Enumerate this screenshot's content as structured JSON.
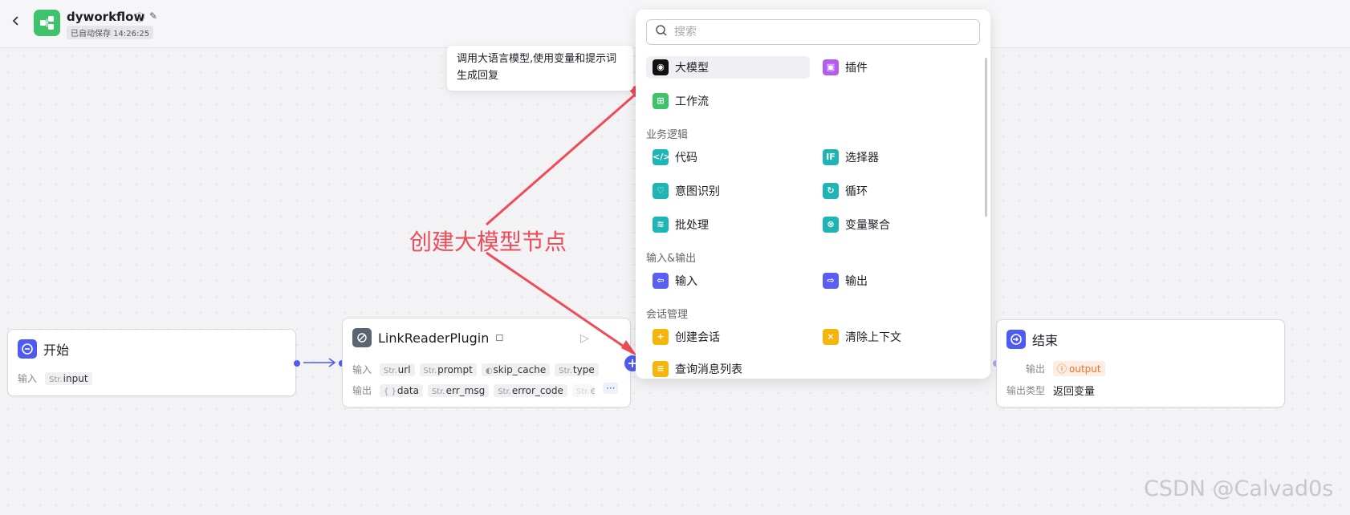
{
  "header": {
    "back_icon": "chevron-left-icon",
    "app_icon": "workflow-icon",
    "title": "dyworkflow",
    "save_status": "已自动保存 14:26:25",
    "accent": "#3ec26b"
  },
  "nodes": {
    "start": {
      "title": "开始",
      "input_label": "输入",
      "input_tag_type": "Str.",
      "input_tag": "input"
    },
    "plugin": {
      "title": "LinkReaderPlugin",
      "input_label": "输入",
      "inputs": [
        {
          "type": "Str.",
          "name": "url"
        },
        {
          "type": "Str.",
          "name": "prompt"
        },
        {
          "type": "◐",
          "name": "skip_cache"
        },
        {
          "type": "Str.",
          "name": "type"
        }
      ],
      "output_label": "输出",
      "outputs": [
        {
          "type": "{ }",
          "name": "data"
        },
        {
          "type": "Str.",
          "name": "err_msg"
        },
        {
          "type": "Str.",
          "name": "error_code"
        },
        {
          "type": "Str.",
          "name": "er"
        }
      ],
      "more": "···"
    },
    "end": {
      "title": "结束",
      "output_label": "输出",
      "output_tag": "output",
      "output_type_label": "输出类型",
      "output_type_value": "返回变量"
    }
  },
  "panel": {
    "search_placeholder": "搜索",
    "items_top": [
      {
        "label": "大模型",
        "icon": "llm-icon",
        "color": "#111111"
      },
      {
        "label": "插件",
        "icon": "plugin-icon",
        "color": "#b55cf0"
      },
      {
        "label": "工作流",
        "icon": "workflow-icon",
        "color": "#3ec26b"
      }
    ],
    "sections": [
      {
        "title": "业务逻辑",
        "items": [
          {
            "label": "代码",
            "icon": "code-icon",
            "color": "#1fb5b5"
          },
          {
            "label": "选择器",
            "icon": "if-icon",
            "color": "#1fb5b5"
          },
          {
            "label": "意图识别",
            "icon": "intent-icon",
            "color": "#1fb5b5"
          },
          {
            "label": "循环",
            "icon": "loop-icon",
            "color": "#1fb5b5"
          },
          {
            "label": "批处理",
            "icon": "batch-icon",
            "color": "#1fb5b5"
          },
          {
            "label": "变量聚合",
            "icon": "variable-merge-icon",
            "color": "#1fb5b5"
          }
        ]
      },
      {
        "title": "输入&输出",
        "items": [
          {
            "label": "输入",
            "icon": "input-icon",
            "color": "#5a5ef2"
          },
          {
            "label": "输出",
            "icon": "output-icon",
            "color": "#5a5ef2"
          }
        ]
      },
      {
        "title": "会话管理",
        "items": [
          {
            "label": "创建会话",
            "icon": "create-chat-icon",
            "color": "#f5b50a"
          },
          {
            "label": "清除上下文",
            "icon": "clear-context-icon",
            "color": "#f5b50a"
          },
          {
            "label": "查询消息列表",
            "icon": "message-list-icon",
            "color": "#f5b50a"
          }
        ]
      }
    ]
  },
  "tooltip": {
    "text": "调用大语言模型,使用变量和提示词生成回复"
  },
  "annotation": {
    "text": "创建大模型节点",
    "color": "#ef4b59"
  },
  "watermark": "CSDN @Calvad0s"
}
